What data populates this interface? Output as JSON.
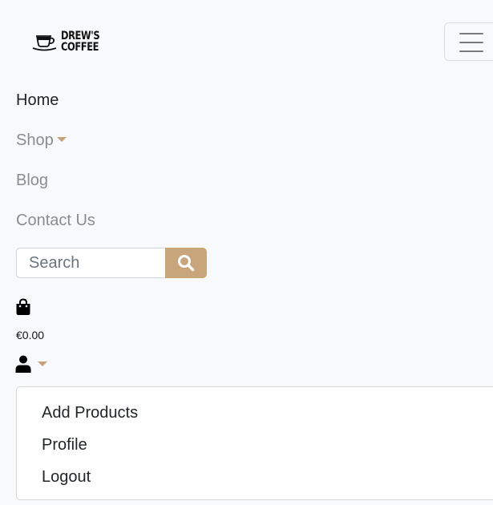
{
  "brand": {
    "line1": "DREW'S",
    "line2": "COFFEE",
    "icon": "coffee-cup-icon"
  },
  "navbar": {
    "toggler_icon": "hamburger-icon",
    "links": {
      "home": "Home",
      "shop": "Shop",
      "blog": "Blog",
      "contact": "Contact Us"
    }
  },
  "search": {
    "placeholder": "Search",
    "value": "",
    "button_icon": "search-icon"
  },
  "cart": {
    "icon": "shopping-bag-icon",
    "total": "€0.00"
  },
  "account": {
    "icon": "user-icon",
    "menu": {
      "add_products": "Add Products",
      "profile": "Profile",
      "logout": "Logout"
    }
  },
  "colors": {
    "accent": "#c9a57c",
    "background": "#f8f9fa",
    "nav_text": "#8c8c8c",
    "active_text": "#212529"
  }
}
